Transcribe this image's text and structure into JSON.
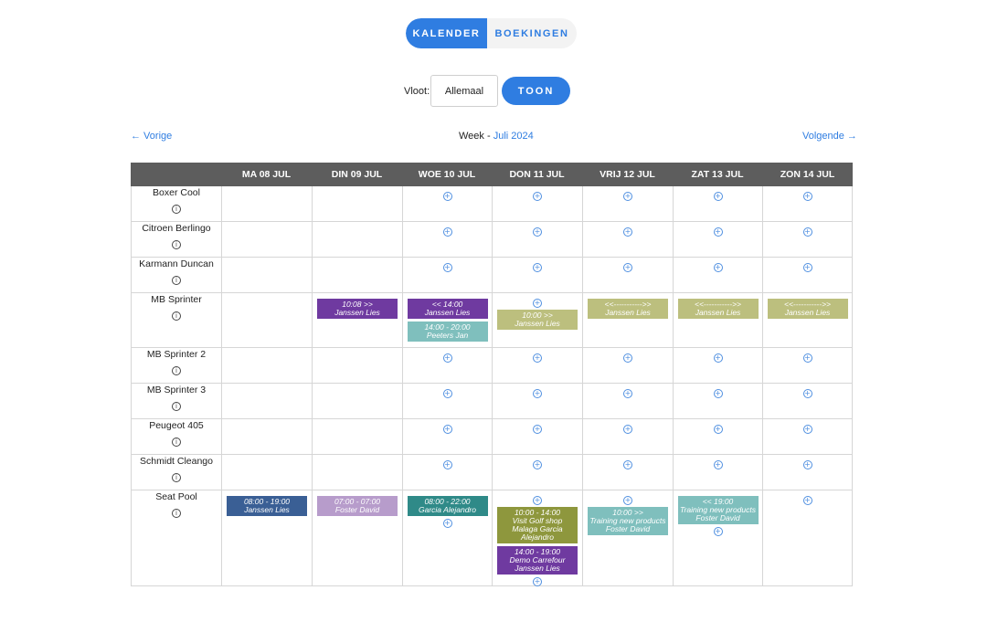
{
  "toggle": {
    "kalender": "Kalender",
    "boekingen": "Boekingen"
  },
  "filter": {
    "label": "Vloot:",
    "select_value": "Allemaal",
    "button": "TOON"
  },
  "nav": {
    "prev": "← Vorige",
    "next": "Volgende →",
    "week_prefix": "Week - ",
    "month": "Juli 2024"
  },
  "calendar": {
    "days": [
      "MA 08 JUL",
      "DIN 09 JUL",
      "WOE 10 JUL",
      "DON 11 JUL",
      "VRIJ 12 JUL",
      "ZAT 13 JUL",
      "ZON 14 JUL"
    ],
    "rows": [
      {
        "name": "Boxer Cool",
        "cells": [
          [],
          [],
          [
            "+"
          ],
          [
            "+"
          ],
          [
            "+"
          ],
          [
            "+"
          ],
          [
            "+"
          ]
        ]
      },
      {
        "name": "Citroen Berlingo",
        "cells": [
          [],
          [],
          [
            "+"
          ],
          [
            "+"
          ],
          [
            "+"
          ],
          [
            "+"
          ],
          [
            "+"
          ]
        ]
      },
      {
        "name": "Karmann Duncan",
        "cells": [
          [],
          [],
          [
            "+"
          ],
          [
            "+"
          ],
          [
            "+"
          ],
          [
            "+"
          ],
          [
            "+"
          ]
        ]
      },
      {
        "name": "MB Sprinter",
        "cells": [
          [],
          [
            {
              "time": "10:08 >>",
              "name": "Janssen Lies",
              "color": "#6f3aa0"
            }
          ],
          [
            {
              "time": "<< 14:00",
              "name": "Janssen Lies",
              "color": "#6f3aa0"
            },
            {
              "time": "14:00 - 20:00",
              "name": "Peeters Jan",
              "color": "#7fbfbd"
            }
          ],
          [
            "+",
            {
              "time": "10:00 >>",
              "name": "Janssen Lies",
              "color": "#bcbf7e"
            }
          ],
          [
            {
              "time": "<<----------->>",
              "name": "Janssen Lies",
              "color": "#bcbf7e"
            }
          ],
          [
            {
              "time": "<<----------->>",
              "name": "Janssen Lies",
              "color": "#bcbf7e"
            }
          ],
          [
            {
              "time": "<<----------->>",
              "name": "Janssen Lies",
              "color": "#bcbf7e"
            }
          ]
        ]
      },
      {
        "name": "MB Sprinter 2",
        "cells": [
          [],
          [],
          [
            "+"
          ],
          [
            "+"
          ],
          [
            "+"
          ],
          [
            "+"
          ],
          [
            "+"
          ]
        ]
      },
      {
        "name": "MB Sprinter 3",
        "cells": [
          [],
          [],
          [
            "+"
          ],
          [
            "+"
          ],
          [
            "+"
          ],
          [
            "+"
          ],
          [
            "+"
          ]
        ]
      },
      {
        "name": "Peugeot 405",
        "cells": [
          [],
          [],
          [
            "+"
          ],
          [
            "+"
          ],
          [
            "+"
          ],
          [
            "+"
          ],
          [
            "+"
          ]
        ]
      },
      {
        "name": "Schmidt Cleango",
        "cells": [
          [],
          [],
          [
            "+"
          ],
          [
            "+"
          ],
          [
            "+"
          ],
          [
            "+"
          ],
          [
            "+"
          ]
        ]
      },
      {
        "name": "Seat Pool",
        "cells": [
          [
            {
              "time": "08:00 - 19:00",
              "name": "Janssen Lies",
              "color": "#3a5f95"
            }
          ],
          [
            {
              "time": "07:00 - 07:00",
              "name": "Foster David",
              "color": "#b79ccb"
            }
          ],
          [
            {
              "time": "08:00 - 22:00",
              "name": "Garcia Alejandro",
              "color": "#2f8a88"
            },
            "+"
          ],
          [
            "+",
            {
              "time": "10:00 - 14:00",
              "name": "Visit Golf shop Malaga Garcia Alejandro",
              "color": "#8e973d"
            },
            {
              "time": "14:00 - 19:00",
              "name": "Demo Carrefour Janssen Lies",
              "color": "#6f3aa0"
            },
            "+"
          ],
          [
            "+",
            {
              "time": "10:00 >>",
              "name": "Training new products Foster David",
              "color": "#7fbfbd"
            }
          ],
          [
            {
              "time": "<< 19:00",
              "name": "Training new products Foster David",
              "color": "#7fbfbd"
            },
            "+"
          ],
          [
            "+"
          ]
        ]
      }
    ]
  }
}
